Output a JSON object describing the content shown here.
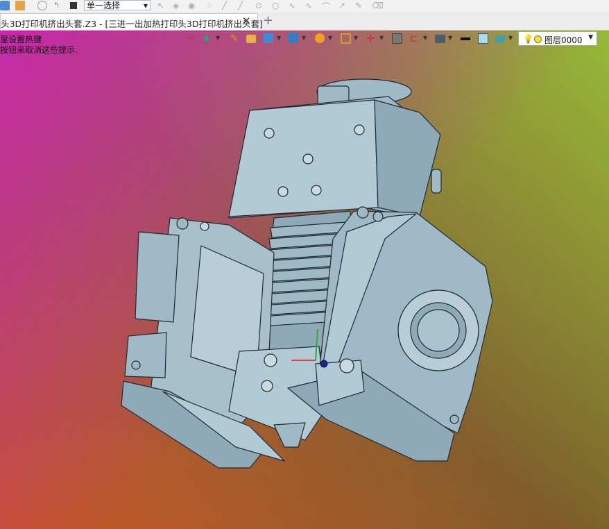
{
  "toolbar": {
    "selection_mode": "单一选择",
    "icons": [
      "save-icon",
      "image-icon",
      "history-icon",
      "redo-icon",
      "stop-icon",
      "cursor-icon",
      "pick-icon",
      "play-icon",
      "point-icon",
      "line-icon",
      "line2-icon",
      "circle-icon",
      "circle2-icon",
      "curve-icon",
      "curve2-icon",
      "arc-icon",
      "pen-icon",
      "brush-icon",
      "eraser-icon"
    ]
  },
  "tabs": [
    {
      "label": "头3D打印机挤出头套.Z3 - [三进一出加热打印头3D打印机挤出头套]",
      "close": "✕"
    }
  ],
  "add_tab": "+",
  "hints": [
    "里设置热键",
    "按钮来取消这些提示."
  ],
  "view_toolbar": {
    "layer_name": "图层0000",
    "icons": [
      "import-icon",
      "person-icon",
      "pen-icon",
      "box-icon",
      "cube-icon",
      "view-cube-icon",
      "render-icon",
      "frame-icon",
      "axis-icon",
      "grid-icon",
      "dimension-icon",
      "display-icon",
      "color-line-icon",
      "color-box-icon",
      "layers-icon",
      "bulb-icon"
    ]
  },
  "colors": {
    "model": "#9fb9c6",
    "model_edge": "#1f2a30",
    "layer_dot": "#f0e43a"
  }
}
